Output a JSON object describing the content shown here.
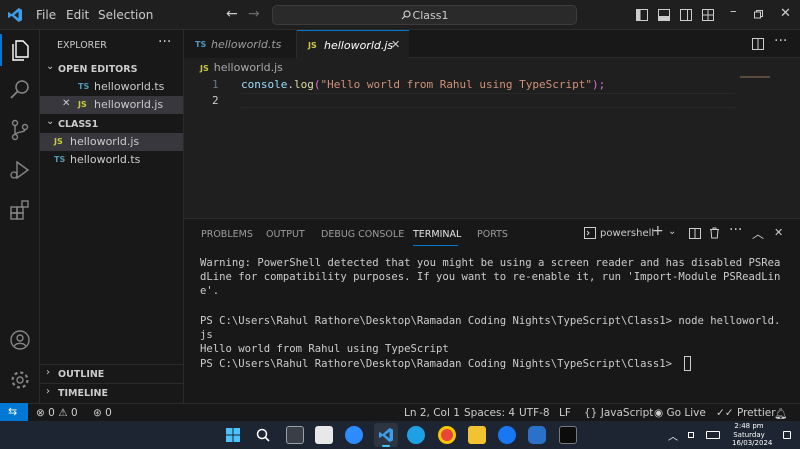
{
  "titlebar": {
    "menu": [
      "File",
      "Edit",
      "Selection"
    ],
    "search": "Class1"
  },
  "sidebar": {
    "title": "EXPLORER",
    "open_editors": {
      "heading": "OPEN EDITORS",
      "items": [
        {
          "badge": "TS",
          "name": "helloworld.ts"
        },
        {
          "badge": "JS",
          "name": "helloworld.js"
        }
      ]
    },
    "folder": {
      "heading": "CLASS1",
      "items": [
        {
          "badge": "JS",
          "name": "helloworld.js"
        },
        {
          "badge": "TS",
          "name": "helloworld.ts"
        }
      ]
    },
    "outline": "OUTLINE",
    "timeline": "TIMELINE"
  },
  "tabs": [
    {
      "badge": "TS",
      "name": "helloworld.ts",
      "active": false
    },
    {
      "badge": "JS",
      "name": "helloworld.js",
      "active": true
    }
  ],
  "breadcrumb": {
    "badge": "JS",
    "name": "helloworld.js"
  },
  "editor": {
    "line_numbers": [
      "1",
      "2"
    ],
    "code": {
      "object": "console",
      "dot": ".",
      "method": "log",
      "open": "(",
      "string": "\"Hello world from Rahul using TypeScript\"",
      "close": ");"
    }
  },
  "panel": {
    "tabs": [
      "PROBLEMS",
      "OUTPUT",
      "DEBUG CONSOLE",
      "TERMINAL",
      "PORTS"
    ],
    "active_tab": "TERMINAL",
    "shell": "powershell",
    "terminal_lines": [
      "Warning: PowerShell detected that you might be using a screen reader and has disabled PSRea",
      "dLine for compatibility purposes. If you want to re-enable it, run 'Import-Module PSReadLin",
      "e'.",
      "",
      "PS C:\\Users\\Rahul Rathore\\Desktop\\Ramadan Coding Nights\\TypeScript\\Class1> node helloworld.",
      "js",
      "Hello world from Rahul using TypeScript",
      "PS C:\\Users\\Rahul Rathore\\Desktop\\Ramadan Coding Nights\\TypeScript\\Class1> "
    ]
  },
  "statusbar": {
    "remote_icon": "remote-icon",
    "errors": "0",
    "warnings": "0",
    "ports": "0",
    "position": "Ln 2, Col 1",
    "spaces": "Spaces: 4",
    "encoding": "UTF-8",
    "eol": "LF",
    "language": "JavaScript",
    "golive": "Go Live",
    "prettier": "Prettier"
  },
  "taskbar": {
    "time": "2:48 pm",
    "day": "Saturday",
    "date": "16/03/2024"
  },
  "colors": {
    "accent": "#0078d4",
    "keyword_yellow": "#dcdcaa",
    "variable_blue": "#9cdcfe",
    "string_orange": "#ce9178",
    "ts_blue": "#519aba",
    "js_yellow": "#cbcb41"
  }
}
